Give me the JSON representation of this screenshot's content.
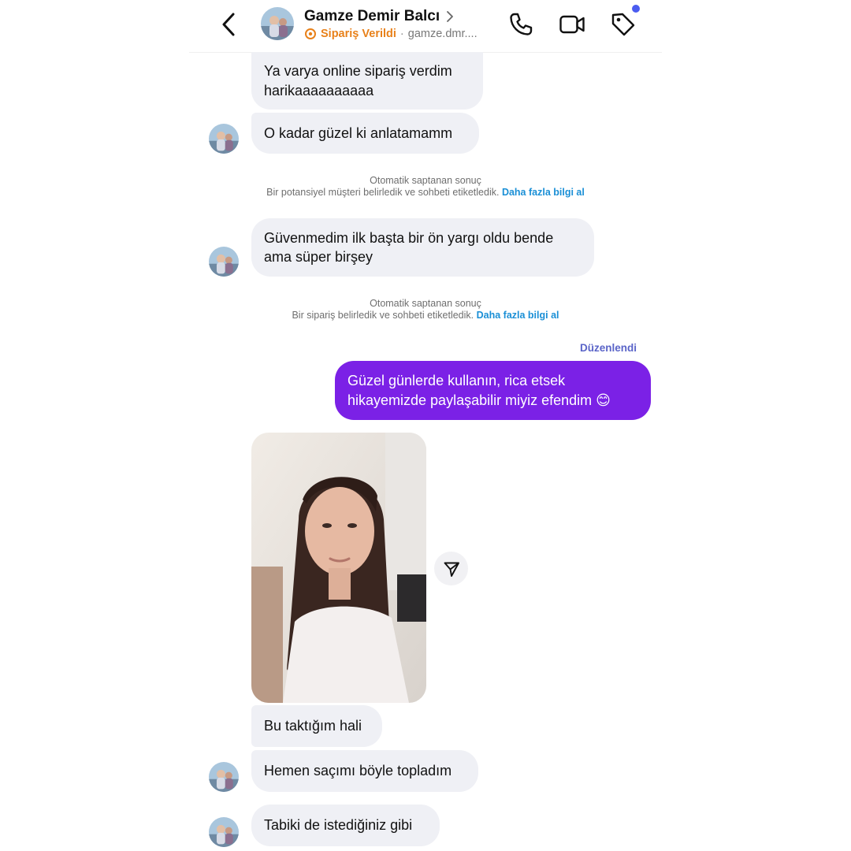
{
  "header": {
    "name": "Gamze Demir Balcı",
    "order_status": "Sipariş Verildi",
    "separator": "·",
    "username": "gamze.dmr...."
  },
  "messages": {
    "m1": "Ya varya online sipariş verdim\nharikaaaaaaaaaa",
    "m2": "O kadar güzel ki anlatamamm",
    "sys1_title": "Otomatik saptanan sonuç",
    "sys1_text": "Bir potansiyel müşteri belirledik ve sohbeti etiketledik.",
    "sys1_link": "Daha fazla bilgi al",
    "m3": "Güvenmedim ilk başta bir ön yargı oldu bende\nama süper birşey",
    "sys2_title": "Otomatik saptanan sonuç",
    "sys2_text": "Bir sipariş belirledik ve sohbeti etiketledik.",
    "sys2_link": "Daha fazla bilgi al",
    "edited_label": "Düzenlendi",
    "m4": "Güzel günlerde kullanın, rica etsek\nhikayemizde paylaşabilir miyiz efendim 😊",
    "m5": "Bu taktığım hali",
    "m6": "Hemen saçımı böyle topladım",
    "m7": "Tabiki de istediğiniz gibi"
  },
  "colors": {
    "incoming_bubble": "#eff0f5",
    "outgoing_bubble": "#7b21e6",
    "order_status": "#e8811a",
    "link": "#1a8fd6",
    "edited": "#5a64c8",
    "notification_dot": "#4b5cf0"
  },
  "icons": {
    "back": "chevron-left-icon",
    "call": "phone-icon",
    "video": "video-camera-icon",
    "tag": "tag-icon",
    "order": "order-badge-icon",
    "share": "send-icon"
  }
}
